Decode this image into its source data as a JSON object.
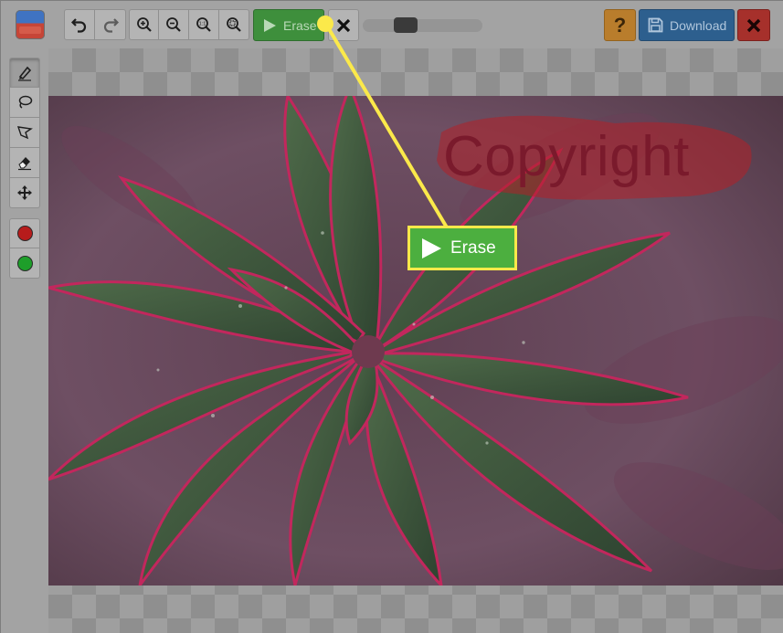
{
  "toolbar": {
    "app_logo": "app-logo-icon",
    "undo_icon": "undo-icon",
    "redo_icon": "redo-icon",
    "zoom_in_icon": "zoom-in-icon",
    "zoom_out_icon": "zoom-out-icon",
    "zoom_actual_icon": "zoom-actual-size-icon",
    "zoom_fit_icon": "zoom-fit-icon",
    "erase_label": "Erase",
    "cancel_icon": "close-icon",
    "brush_size_fraction": 0.32,
    "help_label": "?",
    "download_label": "Download",
    "close_icon": "close-icon"
  },
  "palette": {
    "tools": [
      "marker-icon",
      "lasso-icon",
      "polygon-lasso-icon",
      "eraser-icon",
      "move-icon"
    ],
    "active_tool": "marker-icon",
    "colors": [
      {
        "name": "remove-color",
        "hex": "#b71c1c"
      },
      {
        "name": "keep-color",
        "hex": "#1e9e2a"
      }
    ]
  },
  "canvas": {
    "watermark_text": "Copyright",
    "callout_label": "Erase",
    "highlight_color": "#fbe94a"
  },
  "colors": {
    "erase_green": "#3e8f3c",
    "download_blue": "#2d5f8e",
    "help_orange": "#b97d2c",
    "close_red": "#a6302b"
  }
}
